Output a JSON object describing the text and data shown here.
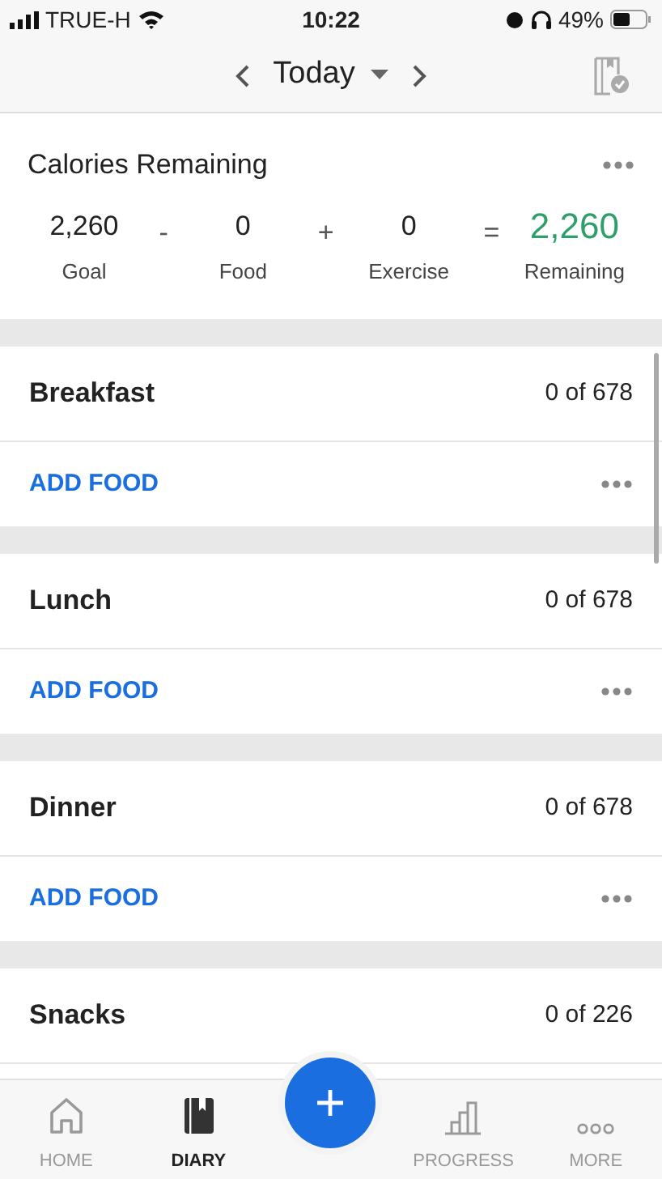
{
  "status_bar": {
    "carrier": "TRUE-H",
    "time": "10:22",
    "battery": "49%"
  },
  "header": {
    "title": "Today"
  },
  "calories": {
    "title": "Calories Remaining",
    "items": [
      {
        "value": "2,260",
        "label": "Goal",
        "kind": "term"
      },
      {
        "value": "-",
        "kind": "operator"
      },
      {
        "value": "0",
        "label": "Food",
        "kind": "term"
      },
      {
        "value": "+",
        "kind": "operator"
      },
      {
        "value": "0",
        "label": "Exercise",
        "kind": "term"
      },
      {
        "value": "=",
        "kind": "operator"
      },
      {
        "value": "2,260",
        "label": "Remaining",
        "kind": "result"
      }
    ]
  },
  "meals": [
    {
      "name": "Breakfast",
      "calories": "0 of 678",
      "add_label": "ADD FOOD"
    },
    {
      "name": "Lunch",
      "calories": "0 of 678",
      "add_label": "ADD FOOD"
    },
    {
      "name": "Dinner",
      "calories": "0 of 678",
      "add_label": "ADD FOOD"
    },
    {
      "name": "Snacks",
      "calories": "0 of 226"
    }
  ],
  "tabs": [
    {
      "label": "HOME",
      "kind": "home",
      "selected": false
    },
    {
      "label": "DIARY",
      "kind": "diary",
      "selected": true
    },
    {
      "kind": "add",
      "selected": false
    },
    {
      "label": "PROGRESS",
      "kind": "progress",
      "selected": false
    },
    {
      "label": "MORE",
      "kind": "more",
      "selected": false
    }
  ]
}
